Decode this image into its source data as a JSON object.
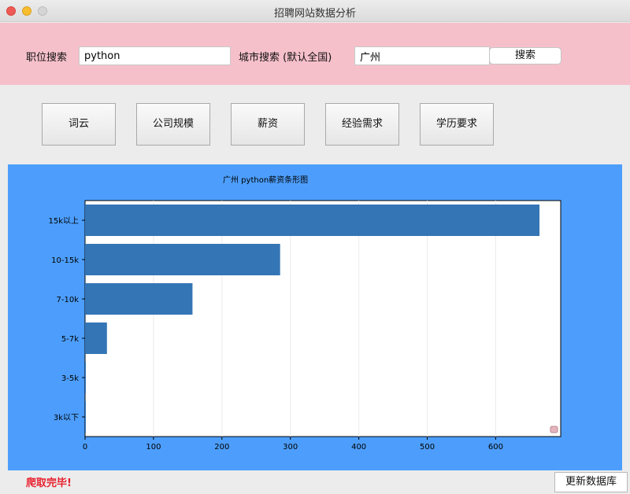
{
  "window": {
    "title": "招聘网站数据分析"
  },
  "search": {
    "job_label": "职位搜索",
    "job_value": "python",
    "city_label": "城市搜索 (默认全国)",
    "city_value": "广州",
    "button_label": "搜索"
  },
  "categories": [
    {
      "label": "词云"
    },
    {
      "label": "公司规模"
    },
    {
      "label": "薪资"
    },
    {
      "label": "经验需求"
    },
    {
      "label": "学历要求"
    }
  ],
  "chart_data": {
    "type": "bar",
    "orientation": "horizontal",
    "title": "广州 python薪资条形图",
    "categories": [
      "15k以上",
      "10-15k",
      "7-10k",
      "5-7k",
      "3-5k",
      "3k以下"
    ],
    "values": [
      664,
      285,
      157,
      32,
      1,
      1
    ],
    "xlabel": "",
    "ylabel": "",
    "xlim": [
      0,
      695
    ],
    "xticks": [
      0,
      100,
      200,
      300,
      400,
      500,
      600
    ],
    "bar_color": "#3475b5",
    "panel_color": "#4d9efc",
    "grid": "vertical"
  },
  "status": {
    "text": "爬取完毕!"
  },
  "update": {
    "label": "更新数据库"
  }
}
